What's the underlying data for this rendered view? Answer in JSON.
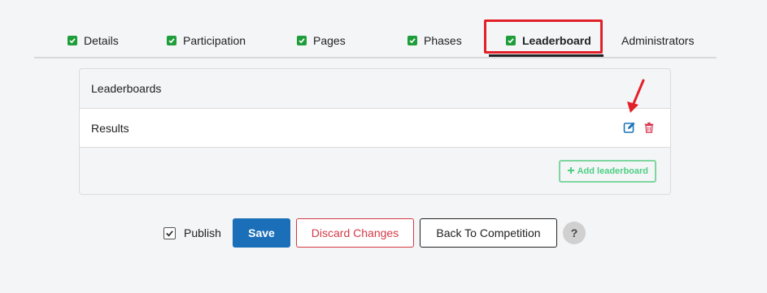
{
  "tabs": [
    {
      "label": "Details",
      "checked": true
    },
    {
      "label": "Participation",
      "checked": true
    },
    {
      "label": "Pages",
      "checked": true
    },
    {
      "label": "Phases",
      "checked": true
    },
    {
      "label": "Leaderboard",
      "checked": true,
      "active": true
    },
    {
      "label": "Administrators",
      "checked": false
    }
  ],
  "panel": {
    "header": "Leaderboards",
    "rows": [
      {
        "name": "Results"
      }
    ],
    "add_button": "Add leaderboard"
  },
  "icons": {
    "tab_check": "check-icon",
    "edit": "edit-icon",
    "delete": "trash-icon",
    "add": "plus-icon",
    "annotation": "red-arrow"
  },
  "footer": {
    "publish_label": "Publish",
    "publish_checked": true,
    "save_label": "Save",
    "discard_label": "Discard Changes",
    "back_label": "Back To Competition",
    "help_label": "?"
  },
  "colors": {
    "check_green": "#1f9d3a",
    "highlight_red": "#e3202a",
    "save_blue": "#1a6fb8",
    "edit_blue": "#1a73b8",
    "delete_red": "#d9304a",
    "add_green": "#4ccf83"
  }
}
